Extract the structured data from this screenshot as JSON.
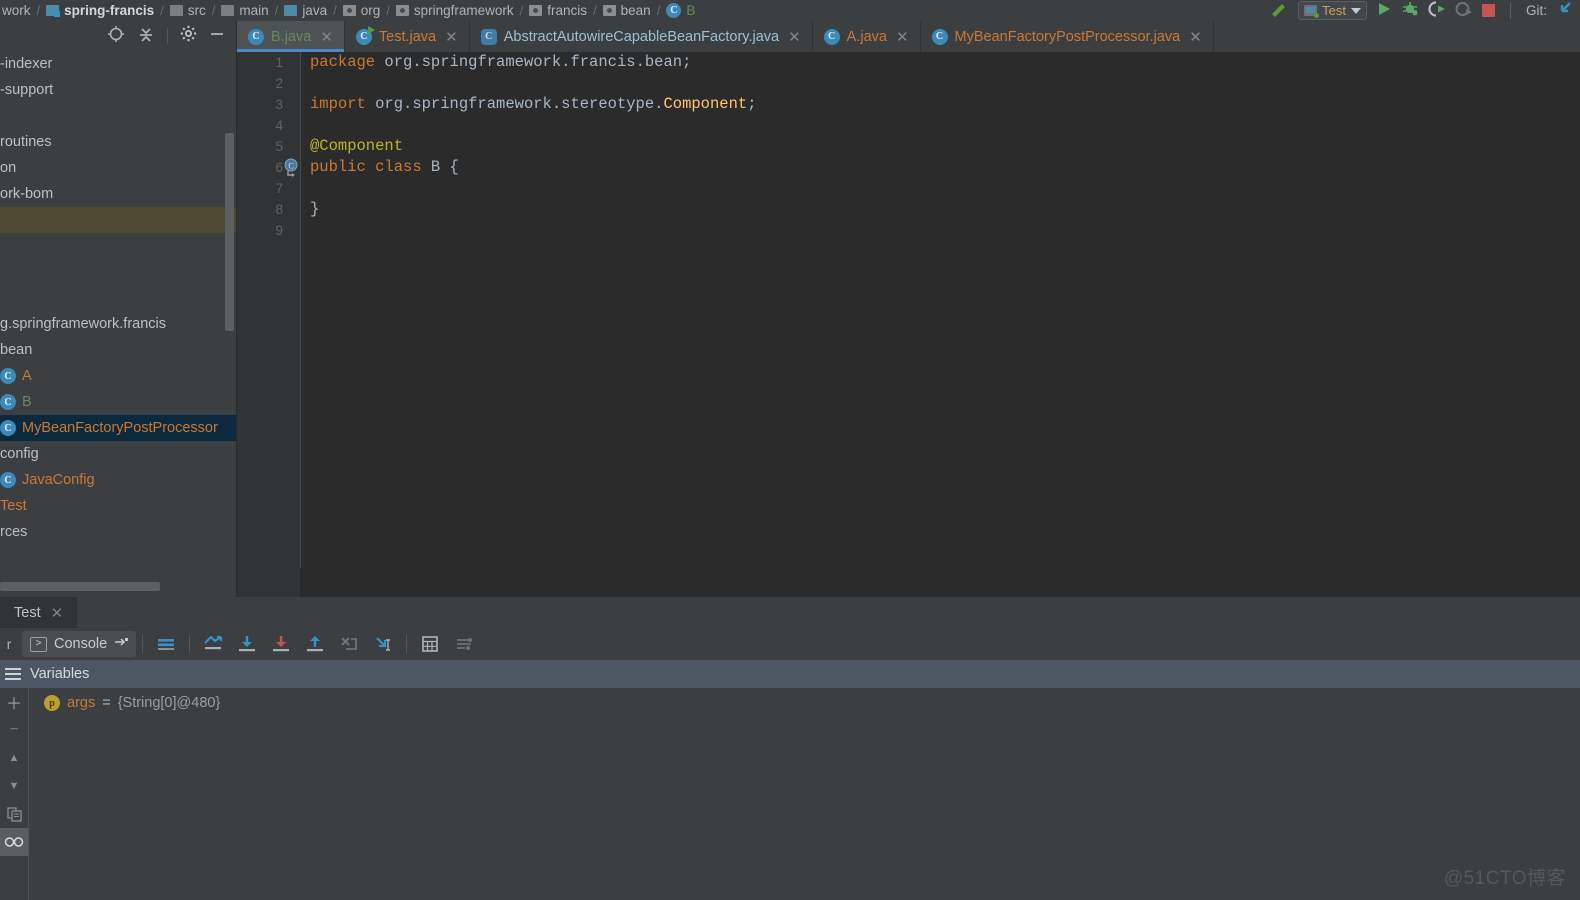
{
  "navbar": {
    "breadcrumbs": [
      {
        "label": "work",
        "icon": "none",
        "style": "plain"
      },
      {
        "label": "spring-francis",
        "icon": "module-icon",
        "style": "bold"
      },
      {
        "label": "src",
        "icon": "folder-icon",
        "style": "plain"
      },
      {
        "label": "main",
        "icon": "folder-icon",
        "style": "plain"
      },
      {
        "label": "java",
        "icon": "source-folder-icon",
        "style": "plain"
      },
      {
        "label": "org",
        "icon": "package-icon",
        "style": "plain"
      },
      {
        "label": "springframework",
        "icon": "package-icon",
        "style": "plain"
      },
      {
        "label": "francis",
        "icon": "package-icon",
        "style": "plain"
      },
      {
        "label": "bean",
        "icon": "package-icon",
        "style": "plain"
      },
      {
        "label": "B",
        "icon": "class-icon",
        "style": "class"
      }
    ],
    "separator": "/",
    "right": {
      "build_icon": "hammer-icon",
      "run_config": "Test",
      "run_icon": "run-icon",
      "debug_icon": "debug-icon",
      "run_coverage_icon": "run-with-coverage-icon",
      "profile_icon": "profile-icon",
      "stop_icon": "stop-icon",
      "git_label": "Git:",
      "git_update_icon": "update-project-icon"
    }
  },
  "project_panel": {
    "toolbar": [
      {
        "name": "select-opened-file-icon",
        "glyph": "target"
      },
      {
        "name": "collapse-all-icon",
        "glyph": "collapse"
      },
      {
        "name": "settings-gear-icon",
        "glyph": "gear"
      },
      {
        "name": "hide-panel-icon",
        "glyph": "minus"
      }
    ],
    "tree": [
      {
        "label": "-indexer",
        "type": "module",
        "color": "plain"
      },
      {
        "label": "-support",
        "type": "module",
        "color": "plain"
      },
      {
        "label": "",
        "type": "spacer",
        "color": "plain"
      },
      {
        "label": "routines",
        "type": "module",
        "color": "plain"
      },
      {
        "label": "on",
        "type": "module",
        "color": "plain"
      },
      {
        "label": "ork-bom",
        "type": "module",
        "color": "plain"
      },
      {
        "label": "",
        "type": "band",
        "color": "plain"
      },
      {
        "label": "",
        "type": "spacer",
        "color": "plain"
      },
      {
        "label": "",
        "type": "spacer",
        "color": "plain"
      },
      {
        "label": "",
        "type": "spacer",
        "color": "plain"
      },
      {
        "label": "g.springframework.francis",
        "type": "package",
        "color": "plain"
      },
      {
        "label": "bean",
        "type": "package",
        "color": "plain"
      },
      {
        "label": "A",
        "type": "class",
        "color": "orange"
      },
      {
        "label": "B",
        "type": "class",
        "color": "green"
      },
      {
        "label": "MyBeanFactoryPostProcessor",
        "type": "class",
        "color": "orange",
        "selected": true
      },
      {
        "label": "config",
        "type": "package",
        "color": "plain"
      },
      {
        "label": "JavaConfig",
        "type": "class",
        "color": "orange"
      },
      {
        "label": "Test",
        "type": "class-noicon",
        "color": "orange"
      },
      {
        "label": "rces",
        "type": "folder",
        "color": "plain"
      }
    ]
  },
  "editor": {
    "tabs": [
      {
        "label": "B.java",
        "icon": "class-icon",
        "color": "green",
        "active": true,
        "closable": true
      },
      {
        "label": "Test.java",
        "icon": "runnable-class-icon",
        "color": "orange",
        "active": false,
        "closable": true
      },
      {
        "label": "AbstractAutowireCapableBeanFactory.java",
        "icon": "abstract-class-icon",
        "color": "blue",
        "active": false,
        "closable": true
      },
      {
        "label": "A.java",
        "icon": "class-icon",
        "color": "orange",
        "active": false,
        "closable": true
      },
      {
        "label": "MyBeanFactoryPostProcessor.java",
        "icon": "class-icon",
        "color": "orange",
        "active": false,
        "closable": true
      }
    ],
    "code_lines": [
      {
        "num": "1",
        "gutter": "",
        "tokens": [
          {
            "t": "package",
            "c": "kw"
          },
          {
            "t": " org.springframework.francis.bean;",
            "c": "txt"
          }
        ]
      },
      {
        "num": "2",
        "gutter": "",
        "tokens": []
      },
      {
        "num": "3",
        "gutter": "",
        "tokens": [
          {
            "t": "import",
            "c": "kw"
          },
          {
            "t": " org.springframework.stereotype.",
            "c": "txt"
          },
          {
            "t": "Component",
            "c": "ident"
          },
          {
            "t": ";",
            "c": "txt"
          }
        ]
      },
      {
        "num": "4",
        "gutter": "",
        "tokens": []
      },
      {
        "num": "5",
        "gutter": "",
        "tokens": [
          {
            "t": "@Component",
            "c": "ann"
          }
        ]
      },
      {
        "num": "6",
        "gutter": "spring-bean-icon",
        "tokens": [
          {
            "t": "public class",
            "c": "kw"
          },
          {
            "t": " B {",
            "c": "txt"
          }
        ]
      },
      {
        "num": "7",
        "gutter": "",
        "tokens": []
      },
      {
        "num": "8",
        "gutter": "",
        "tokens": [
          {
            "t": "}",
            "c": "txt"
          }
        ]
      },
      {
        "num": "9",
        "gutter": "",
        "tokens": []
      }
    ]
  },
  "debug_panel": {
    "tab_label": "Test",
    "side_letter": "r",
    "console_button": "Console",
    "toolbar_icons": [
      {
        "name": "show-execution-point-icon",
        "glyph": "exec-point",
        "enabled": true
      },
      {
        "name": "step-over-icon",
        "glyph": "step-over",
        "enabled": true
      },
      {
        "name": "step-into-icon",
        "glyph": "step-into",
        "enabled": true
      },
      {
        "name": "step-out-icon",
        "glyph": "step-out",
        "enabled": true
      },
      {
        "name": "force-step-into-icon",
        "glyph": "force-step-into",
        "enabled": false
      },
      {
        "name": "run-to-cursor-icon",
        "glyph": "run-to-cursor",
        "enabled": true
      },
      {
        "name": "evaluate-expression-icon",
        "glyph": "calculator",
        "enabled": true
      },
      {
        "name": "settings-icon",
        "glyph": "sliders",
        "enabled": false
      }
    ],
    "variables": {
      "header": "Variables",
      "rows": [
        {
          "badge": "p",
          "name": "args",
          "eq": "=",
          "value": "{String[0]@480}"
        }
      ]
    },
    "side_buttons": [
      {
        "name": "add-watch-button",
        "glyph": "+"
      },
      {
        "name": "remove-watch-button",
        "glyph": "−"
      },
      {
        "name": "move-up-button",
        "glyph": "▲"
      },
      {
        "name": "move-down-button",
        "glyph": "▼"
      },
      {
        "name": "copy-button",
        "glyph": "copy"
      },
      {
        "name": "watches-toggle-button",
        "glyph": "glasses",
        "active": true
      }
    ]
  },
  "watermark": "@51CTO博客",
  "colors": {
    "editor_bg": "#2b2b2b",
    "panel_bg": "#3c3f41",
    "gutter_bg": "#313335",
    "accent_blue": "#4a88c7",
    "selection_blue": "#0d293e",
    "vars_header": "#4c5763",
    "keyword_orange": "#cc7832",
    "string_green": "#6a8759",
    "annotation_yellow": "#bbb529",
    "text_grey": "#a9b7c6"
  }
}
